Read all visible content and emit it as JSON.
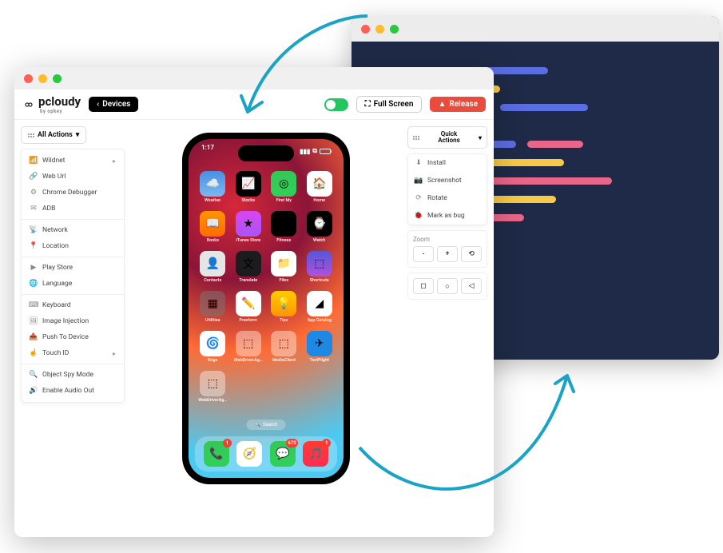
{
  "brand": {
    "name": "pcloudy",
    "sub": "by opkey"
  },
  "toolbar": {
    "devices_label": "Devices",
    "fullscreen_label": "Full Screen",
    "release_label": "Release"
  },
  "all_actions_label": "All Actions",
  "left_actions": {
    "group1": [
      {
        "icon": "📶",
        "label": "Wildnet",
        "chev": true
      },
      {
        "icon": "🔗",
        "label": "Web Url"
      },
      {
        "icon": "⚙",
        "label": "Chrome Debugger"
      },
      {
        "icon": "✉",
        "label": "ADB"
      }
    ],
    "group2": [
      {
        "icon": "📡",
        "label": "Network"
      },
      {
        "icon": "📍",
        "label": "Location"
      }
    ],
    "group3": [
      {
        "icon": "▶",
        "label": "Play Store"
      },
      {
        "icon": "🌐",
        "label": "Language"
      }
    ],
    "group4": [
      {
        "icon": "⌨",
        "label": "Keyboard"
      },
      {
        "icon": "🖼",
        "label": "Image Injection"
      },
      {
        "icon": "📤",
        "label": "Push To Device"
      },
      {
        "icon": "☝",
        "label": "Touch ID",
        "chev": true
      }
    ],
    "group5": [
      {
        "icon": "🔍",
        "label": "Object Spy Mode"
      },
      {
        "icon": "🔊",
        "label": "Enable Audio Out"
      }
    ]
  },
  "quick_actions_label_l1": "Quick",
  "quick_actions_label_l2": "Actions",
  "quick_actions": [
    {
      "icon": "⬇",
      "label": "Install"
    },
    {
      "icon": "📷",
      "label": "Screenshot"
    },
    {
      "icon": "⟳",
      "label": "Rotate"
    },
    {
      "icon": "🐞",
      "label": "Mark as bug"
    }
  ],
  "zoom": {
    "label": "Zoom",
    "minus": "-",
    "plus": "+",
    "reset": "⟲"
  },
  "shapes": {
    "square": "◻",
    "circle": "○",
    "triangle": "◁"
  },
  "phone": {
    "time": "1:17",
    "search_label": "Search",
    "apps_row1": [
      {
        "label": "Weather",
        "bg": "linear-gradient(#4a90e2,#7bb8f0)",
        "glyph": "☁️"
      },
      {
        "label": "Stocks",
        "bg": "#000",
        "glyph": "📈"
      },
      {
        "label": "Find My",
        "bg": "linear-gradient(#34c759,#30d158)",
        "glyph": "◎"
      },
      {
        "label": "Home",
        "bg": "#fff",
        "glyph": "🏠"
      }
    ],
    "apps_row2": [
      {
        "label": "Books",
        "bg": "linear-gradient(#ff9500,#ff6b00)",
        "glyph": "📖"
      },
      {
        "label": "iTunes Store",
        "bg": "linear-gradient(#d946ef,#a855f7)",
        "glyph": "★"
      },
      {
        "label": "Fitness",
        "bg": "#000",
        "glyph": "◉"
      },
      {
        "label": "Watch",
        "bg": "#000",
        "glyph": "⌚"
      }
    ],
    "apps_row3": [
      {
        "label": "Contacts",
        "bg": "#e5e5e5",
        "glyph": "👤"
      },
      {
        "label": "Translate",
        "bg": "#1c1c1e",
        "glyph": "文"
      },
      {
        "label": "Files",
        "bg": "#fff",
        "glyph": "📁"
      },
      {
        "label": "Shortcuts",
        "bg": "linear-gradient(#5856d6,#af52de)",
        "glyph": "⬚"
      }
    ],
    "apps_row4": [
      {
        "label": "Utilities",
        "bg": "rgba(120,120,120,.5)",
        "glyph": "▦"
      },
      {
        "label": "Freeform",
        "bg": "#fff",
        "glyph": "✏️"
      },
      {
        "label": "Tips",
        "bg": "linear-gradient(#ffcc00,#ff9500)",
        "glyph": "💡"
      },
      {
        "label": "App Catalog",
        "bg": "#fff",
        "glyph": "◢"
      }
    ],
    "apps_row5": [
      {
        "label": "Edge",
        "bg": "#fff",
        "glyph": "🌀"
      },
      {
        "label": "WebDriverAgen...",
        "bg": "rgba(255,255,255,.4)",
        "glyph": "⬚"
      },
      {
        "label": "MediaClient",
        "bg": "rgba(255,255,255,.4)",
        "glyph": "⬚"
      },
      {
        "label": "TestFlight",
        "bg": "#1e88e5",
        "glyph": "✈"
      }
    ],
    "apps_row6": [
      {
        "label": "WebDriverAgen...",
        "bg": "rgba(255,255,255,.4)",
        "glyph": "⬚"
      }
    ],
    "dock": [
      {
        "bg": "linear-gradient(#34c759,#30d158)",
        "glyph": "📞",
        "badge": "1"
      },
      {
        "bg": "#fff",
        "glyph": "🧭",
        "badge": null
      },
      {
        "bg": "linear-gradient(#34c759,#30d158)",
        "glyph": "💬",
        "badge": "673"
      },
      {
        "bg": "linear-gradient(#ff3b30,#ff2d55)",
        "glyph": "🎵",
        "badge": "1"
      }
    ]
  },
  "code_bars": [
    [
      {
        "w": 120,
        "c": "#f7c948"
      },
      {
        "w": 90,
        "c": "#5b6ee1"
      }
    ],
    [
      {
        "w": 50,
        "c": "#e8668a",
        "indent": 20
      },
      {
        "w": 80,
        "c": "#f7c948"
      }
    ],
    [
      {
        "w": 150,
        "c": "#5b6ee1"
      },
      {
        "w": 110,
        "c": "#5b6ee1"
      }
    ],
    [
      {
        "w": 60,
        "c": "#5b6ee1",
        "indent": 20
      },
      {
        "w": 50,
        "c": "#f7c948"
      }
    ],
    [
      {
        "w": 70,
        "c": "#f7c948",
        "indent": 40
      },
      {
        "w": 60,
        "c": "#5b6ee1"
      },
      {
        "w": 70,
        "c": "#e8668a"
      }
    ],
    [
      {
        "w": 90,
        "c": "#e8668a",
        "indent": 40
      },
      {
        "w": 100,
        "c": "#f7c948"
      }
    ],
    [
      {
        "w": 60,
        "c": "#f7c948",
        "indent": 60
      },
      {
        "w": 170,
        "c": "#e8668a"
      }
    ],
    [
      {
        "w": 70,
        "c": "#5b6ee1",
        "indent": 60
      },
      {
        "w": 90,
        "c": "#f7c948"
      }
    ],
    [
      {
        "w": 100,
        "c": "#5b6ee1",
        "indent": 20
      },
      {
        "w": 60,
        "c": "#e8668a"
      }
    ]
  ]
}
